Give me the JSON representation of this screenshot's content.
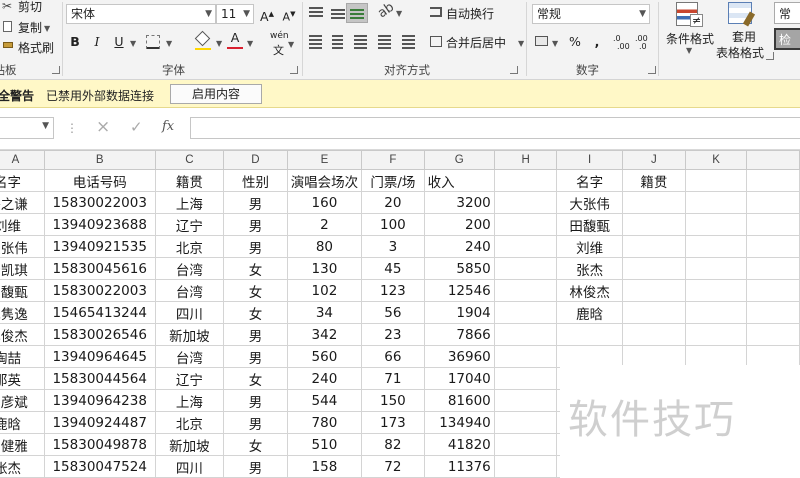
{
  "ribbon": {
    "clipboard": {
      "cut": "剪切",
      "copy": "复制",
      "format_painter": "格式刷",
      "group_label": "粘贴板"
    },
    "font": {
      "font_name": "宋体",
      "font_size": "11",
      "grow": "A",
      "shrink": "A",
      "bold": "B",
      "italic": "I",
      "underline": "U",
      "phonetic": "wén",
      "group_label": "字体"
    },
    "alignment": {
      "wrap_text": "自动换行",
      "merge_center": "合并后居中",
      "group_label": "对齐方式"
    },
    "number": {
      "format": "常规",
      "percent": "%",
      "comma": ",",
      "group_label": "数字"
    },
    "styles": {
      "conditional": "条件格式",
      "table_style_1": "套用",
      "table_style_2": "表格格式",
      "cell_styles_1": "常",
      "cell_styles_2": "检"
    },
    "colors": {
      "fill": "#ffd700",
      "font_color": "#d9202f",
      "selected": "#c5c5c5"
    }
  },
  "security": {
    "title": "安全警告",
    "message": "已禁用外部数据连接",
    "button": "启用内容"
  },
  "formula_bar": {
    "name_box": "",
    "cancel_icon": "×",
    "enter_icon": "✓",
    "fx_icon": "fx",
    "formula": ""
  },
  "sheet": {
    "columns": [
      "A",
      "B",
      "C",
      "D",
      "E",
      "F",
      "G",
      "H",
      "I",
      "J",
      "K"
    ],
    "headers": [
      "名字",
      "电话号码",
      "籍贯",
      "性别",
      "演唱会场次",
      "门票/场",
      "收入"
    ],
    "rows": [
      [
        "薛之谦",
        "15830022003",
        "上海",
        "男",
        "160",
        "20",
        "3200"
      ],
      [
        "刘维",
        "13940923688",
        "辽宁",
        "男",
        "2",
        "100",
        "200"
      ],
      [
        "大张伟",
        "13940921535",
        "北京",
        "男",
        "80",
        "3",
        "240"
      ],
      [
        "萧凯琪",
        "15830045616",
        "台湾",
        "女",
        "130",
        "45",
        "5850"
      ],
      [
        "田馥甄",
        "15830022003",
        "台湾",
        "女",
        "102",
        "123",
        "12546"
      ],
      [
        "克隽逸",
        "15465413244",
        "四川",
        "女",
        "34",
        "56",
        "1904"
      ],
      [
        "林俊杰",
        "15830026546",
        "新加坡",
        "男",
        "342",
        "23",
        "7866"
      ],
      [
        "陶喆",
        "13940964645",
        "台湾",
        "男",
        "560",
        "66",
        "36960"
      ],
      [
        "那英",
        "15830044564",
        "辽宁",
        "女",
        "240",
        "71",
        "17040"
      ],
      [
        "胡彦斌",
        "13940964238",
        "上海",
        "男",
        "544",
        "150",
        "81600"
      ],
      [
        "鹿晗",
        "13940924487",
        "北京",
        "男",
        "780",
        "173",
        "134940"
      ],
      [
        "蔡健雅",
        "15830049878",
        "新加坡",
        "女",
        "510",
        "82",
        "41820"
      ],
      [
        "张杰",
        "15830047524",
        "四川",
        "男",
        "158",
        "72",
        "11376"
      ]
    ],
    "lookup_headers": [
      "名字",
      "籍贯"
    ],
    "lookup_names": [
      "大张伟",
      "田馥甄",
      "刘维",
      "张杰",
      "林俊杰",
      "鹿晗"
    ]
  },
  "watermark": "软件技巧"
}
